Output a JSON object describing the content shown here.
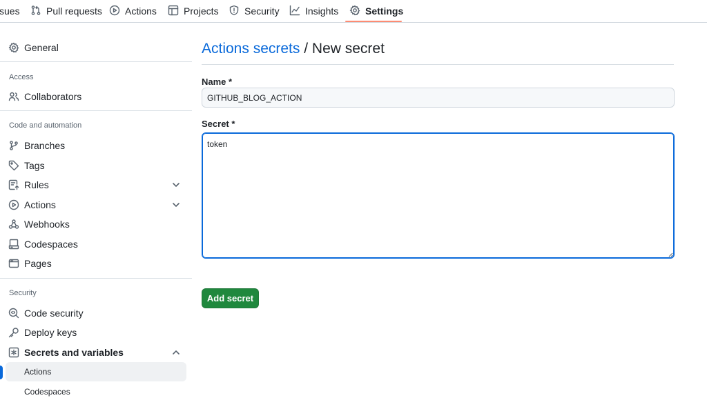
{
  "repo_nav": {
    "tabs": [
      {
        "label": "sues",
        "icon": "issues-icon"
      },
      {
        "label": "Pull requests",
        "icon": "pull-request-icon"
      },
      {
        "label": "Actions",
        "icon": "play-icon"
      },
      {
        "label": "Projects",
        "icon": "table-icon"
      },
      {
        "label": "Security",
        "icon": "shield-icon"
      },
      {
        "label": "Insights",
        "icon": "graph-icon"
      },
      {
        "label": "Settings",
        "icon": "gear-icon",
        "selected": true
      }
    ]
  },
  "sidebar": {
    "general": "General",
    "access_heading": "Access",
    "collaborators": "Collaborators",
    "code_heading": "Code and automation",
    "branches": "Branches",
    "tags": "Tags",
    "rules": "Rules",
    "actions": "Actions",
    "webhooks": "Webhooks",
    "codespaces": "Codespaces",
    "pages": "Pages",
    "security_heading": "Security",
    "code_security": "Code security",
    "deploy_keys": "Deploy keys",
    "secrets_and_variables": "Secrets and variables",
    "sub_actions": "Actions",
    "sub_codespaces": "Codespaces"
  },
  "main": {
    "breadcrumb_link": "Actions secrets",
    "breadcrumb_separator": " / ",
    "breadcrumb_current": "New secret",
    "name_label": "Name *",
    "name_value": "GITHUB_BLOG_ACTION",
    "secret_label": "Secret *",
    "secret_value": "token",
    "submit_label": "Add secret"
  },
  "colors": {
    "accent": "#0969da",
    "primary_button": "#1f883d",
    "selected_tab_underline": "#fd8c73"
  }
}
